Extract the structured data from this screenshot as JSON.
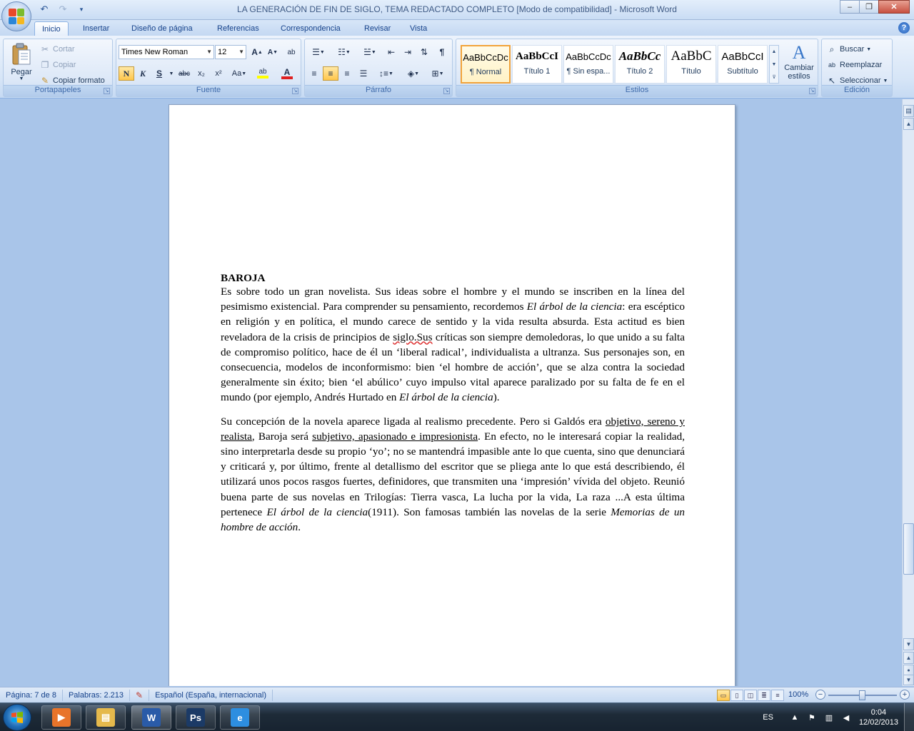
{
  "window": {
    "title": "LA GENERACIÓN DE FIN DE SIGLO, TEMA REDACTADO COMPLETO [Modo de compatibilidad] - Microsoft Word",
    "controls": {
      "minimize": "‒",
      "maximize": "❐",
      "close": "✕"
    }
  },
  "qat": {
    "undo": "↶",
    "redo": "↷",
    "customize": "▾"
  },
  "tabs": [
    "Inicio",
    "Insertar",
    "Diseño de página",
    "Referencias",
    "Correspondencia",
    "Revisar",
    "Vista"
  ],
  "help": "?",
  "ribbon": {
    "clipboard": {
      "label": "Portapapeles",
      "paste": "Pegar",
      "cut": "Cortar",
      "copy": "Copiar",
      "format_painter": "Copiar formato"
    },
    "font": {
      "label": "Fuente",
      "family": "Times New Roman",
      "size": "12",
      "grow": "A",
      "shrink": "A",
      "clear": "ab",
      "bold": "N",
      "italic": "K",
      "underline": "S",
      "strike": "abc",
      "subscript": "x₂",
      "superscript": "x²",
      "case": "Aa",
      "highlight": "ab",
      "color": "A",
      "highlight_color": "#ffff00",
      "font_color": "#e02020"
    },
    "paragraph": {
      "label": "Párrafo"
    },
    "styles": {
      "label": "Estilos",
      "items": [
        {
          "sample": "AaBbCcDc",
          "name": "¶ Normal"
        },
        {
          "sample": "AaBbCcI",
          "name": "Título 1"
        },
        {
          "sample": "AaBbCcDc",
          "name": "¶ Sin espa..."
        },
        {
          "sample": "AaBbCc",
          "name": "Título 2"
        },
        {
          "sample": "AaBbC",
          "name": "Título"
        },
        {
          "sample": "AaBbCcI",
          "name": "Subtítulo"
        }
      ],
      "change_styles_1": "Cambiar",
      "change_styles_2": "estilos"
    },
    "editing": {
      "label": "Edición",
      "find": "Buscar",
      "replace": "Reemplazar",
      "select": "Seleccionar"
    }
  },
  "document": {
    "heading": "BAROJA",
    "p1_a": "Es sobre todo un gran novelista. Sus ideas sobre el hombre y el mundo se inscriben en la línea del pesimismo existencial. Para comprender su pensamiento, recordemos ",
    "p1_title1": "El árbol de la ciencia",
    "p1_b": ": era escéptico en religión y en política, el mundo carece de sentido y la vida resulta absurda. Esta actitud es bien reveladora de la crisis de principios de ",
    "p1_squiggle": "siglo.Sus",
    "p1_c": " críticas son siempre demoledoras, lo que unido a su falta de compromiso político, hace de él un ‘liberal radical’, individualista a ultranza. Sus personajes son, en consecuencia, modelos de inconformismo: bien ‘el hombre de acción’, que se alza contra la sociedad generalmente sin éxito; bien ‘el abúlico’ cuyo impulso vital aparece paralizado por su falta de fe en el mundo (por ejemplo, Andrés Hurtado en ",
    "p1_title2": "El árbol de la ciencia",
    "p1_d": ").",
    "p2_a": "Su concepción de la novela aparece ligada al realismo precedente. Pero si Galdós era ",
    "p2_u1": "objetivo, sereno y realista",
    "p2_b": ", Baroja será ",
    "p2_u2": "subjetivo, apasionado e impresionista",
    "p2_c": ". En efecto, no le interesará copiar la realidad, sino interpretarla desde su propio ‘yo’; no se mantendrá  impasible ante lo que cuenta, sino  que denunciará y criticará y, por último, frente al detallismo del escritor que se pliega ante lo que está describiendo, él utilizará unos pocos rasgos fuertes, definidores, que transmiten una ‘impresión’ vívida del objeto. Reunió buena parte de sus novelas en Trilogías: Tierra vasca, La lucha por la vida, La raza ...A esta última pertenece ",
    "p2_title1": "El árbol de la ciencia",
    "p2_d": "(1911). Son famosas también las novelas de la serie ",
    "p2_title2": "Memorias de un hombre de acción",
    "p2_e": "."
  },
  "statusbar": {
    "page": "Página: 7 de 8",
    "words": "Palabras: 2.213",
    "language": "Español (España, internacional)",
    "zoom": "100%",
    "zoom_minus": "−",
    "zoom_plus": "+",
    "zoom_level_percent": 100
  },
  "taskbar": {
    "language": "ES",
    "time": "0:04",
    "date": "12/02/2013",
    "apps": [
      {
        "icon": "media-player-icon",
        "glyph": "▶",
        "color": "#e8742a"
      },
      {
        "icon": "explorer-folder-icon",
        "glyph": "▤",
        "color": "#e5b94c"
      },
      {
        "icon": "word-icon",
        "glyph": "W",
        "color": "#2a5ba8"
      },
      {
        "icon": "photoshop-icon",
        "glyph": "Ps",
        "color": "#1b3a66"
      },
      {
        "icon": "internet-explorer-icon",
        "glyph": "e",
        "color": "#2d8ee0"
      }
    ]
  }
}
